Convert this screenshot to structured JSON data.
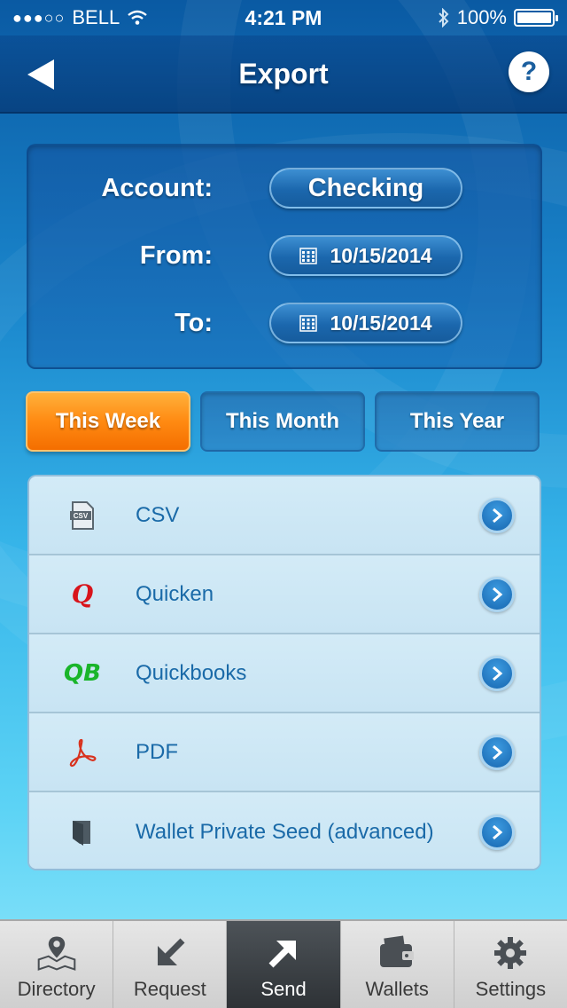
{
  "status_bar": {
    "carrier": "BELL",
    "signal_dots": "●●●○○",
    "time": "4:21 PM",
    "battery": "100%"
  },
  "nav": {
    "title": "Export"
  },
  "form": {
    "account_label": "Account:",
    "account_value": "Checking",
    "from_label": "From:",
    "from_value": "10/15/2014",
    "to_label": "To:",
    "to_value": "10/15/2014"
  },
  "periods": [
    {
      "label": "This Week",
      "selected": true
    },
    {
      "label": "This Month",
      "selected": false
    },
    {
      "label": "This Year",
      "selected": false
    }
  ],
  "export_items": [
    {
      "label": "CSV",
      "icon": "csv-file-icon"
    },
    {
      "label": "Quicken",
      "icon": "quicken-icon",
      "icon_text": "Q",
      "icon_color": "#d8141b"
    },
    {
      "label": "Quickbooks",
      "icon": "quickbooks-icon",
      "icon_text": "QB",
      "icon_color": "#1ab52a"
    },
    {
      "label": "PDF",
      "icon": "pdf-icon",
      "icon_color": "#d8321e"
    },
    {
      "label": "Wallet Private Seed (advanced)",
      "icon": "wallet-seed-icon"
    }
  ],
  "tab_bar": [
    {
      "label": "Directory",
      "icon": "map-pin-icon",
      "selected": false
    },
    {
      "label": "Request",
      "icon": "arrow-down-left-icon",
      "selected": false
    },
    {
      "label": "Send",
      "icon": "arrow-up-right-icon",
      "selected": true
    },
    {
      "label": "Wallets",
      "icon": "wallet-icon",
      "selected": false
    },
    {
      "label": "Settings",
      "icon": "gear-icon",
      "selected": false
    }
  ],
  "colors": {
    "accent_orange": "#ff8a12",
    "link_blue": "#1a6aa8"
  }
}
